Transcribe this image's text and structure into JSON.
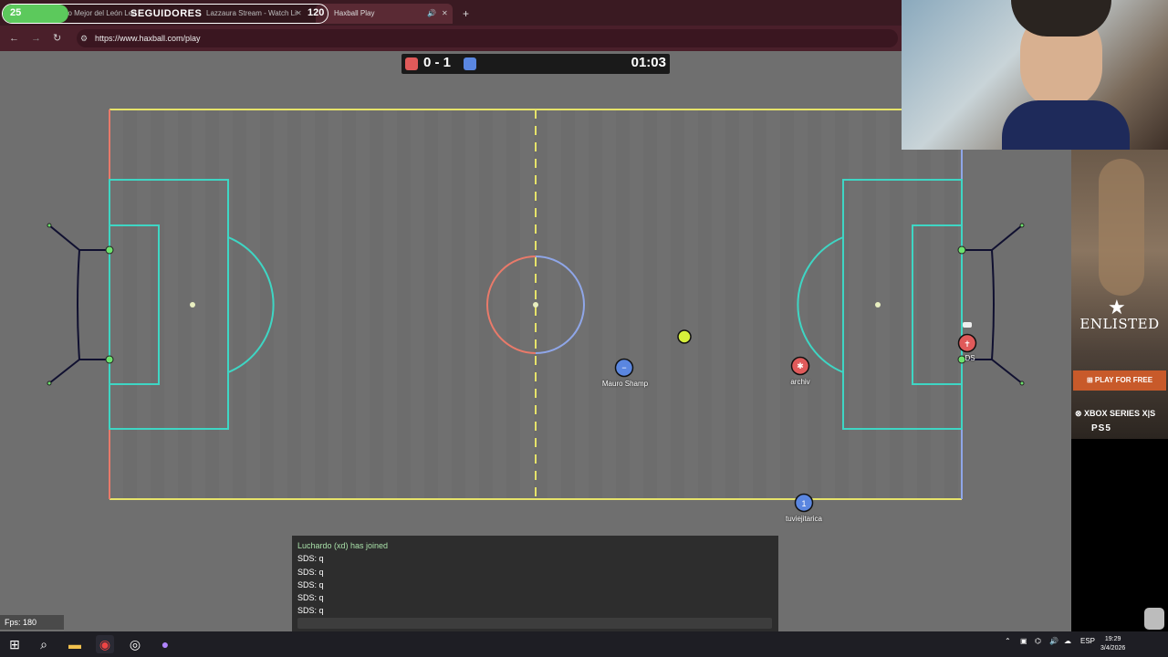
{
  "browser": {
    "tabs": [
      {
        "title": "Lo Mejor del León Leo"
      },
      {
        "title": "Lazzaura Stream - Watch Live"
      },
      {
        "title": "Haxball Play"
      }
    ],
    "new_tab_label": "+",
    "url": "https://www.haxball.com/play"
  },
  "stream_overlay": {
    "followers_count": "25",
    "label": "SEGUIDORES",
    "goal_count": "120"
  },
  "scoreboard": {
    "score": "0 - 1",
    "timer": "01:03",
    "red_color": "#e05a5a",
    "blue_color": "#5a86e0"
  },
  "players": [
    {
      "name": "Mauro Shamp",
      "team": "blue",
      "avatar": "−"
    },
    {
      "name": "archiv",
      "team": "red",
      "avatar": "✱"
    },
    {
      "name": "DS",
      "team": "red",
      "avatar": "✝"
    },
    {
      "name": "tuviejitarica",
      "team": "blue",
      "avatar": "1"
    }
  ],
  "chat": {
    "lines": [
      {
        "text": "Luchardo (xd) has joined",
        "kind": "system"
      },
      {
        "text": "SDS: q",
        "kind": "message"
      },
      {
        "text": "SDS: q",
        "kind": "message"
      },
      {
        "text": "SDS: q",
        "kind": "message"
      },
      {
        "text": "SDS: q",
        "kind": "message"
      },
      {
        "text": "SDS: q",
        "kind": "message"
      }
    ]
  },
  "fps_label": "Fps: 180",
  "ad": {
    "title": "ENLISTED",
    "cta": "PLAY FOR FREE",
    "platform_xbox": "XBOX SERIES X|S",
    "platform_ps": "PS5"
  },
  "taskbar": {
    "language": "ESP",
    "time": "19:29",
    "date": "3/4/2026"
  },
  "colors": {
    "pitch_line": "#e6e36a",
    "box_line": "#3ed6c4",
    "red_goal_line": "#e97a6a",
    "blue_goal_line": "#8fa6e8",
    "ball": "#d7ef3b"
  }
}
